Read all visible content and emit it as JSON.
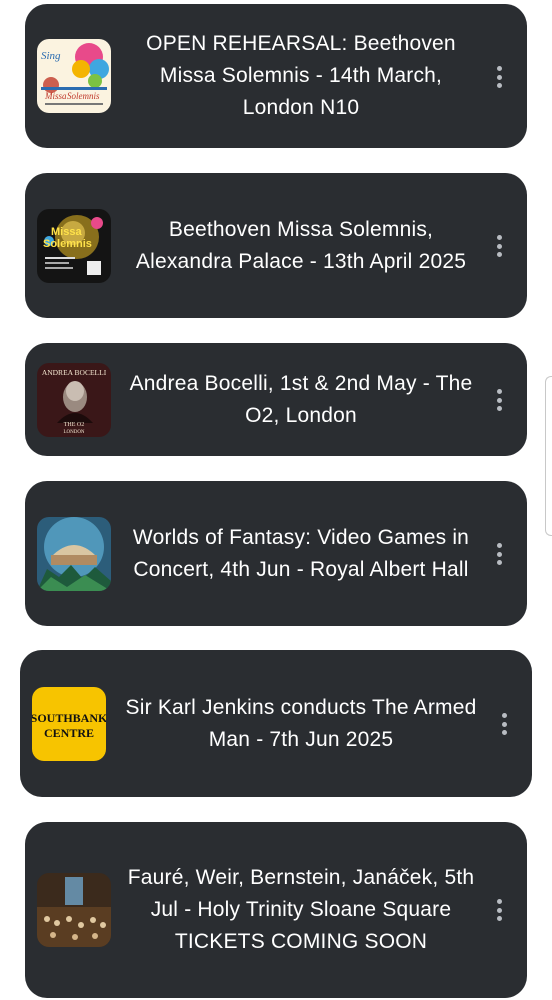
{
  "events": [
    {
      "title": "OPEN REHEARSAL: Beethoven Missa Solemnis - 14th March, London N10",
      "thumb_name": "singfest-missa-solemnis-rehearsal-thumbnail"
    },
    {
      "title": "Beethoven Missa Solemnis, Alexandra Palace - 13th April 2025",
      "thumb_name": "missa-solemnis-poster-thumbnail"
    },
    {
      "title": "Andrea Bocelli, 1st & 2nd May - The O2, London",
      "thumb_name": "andrea-bocelli-poster-thumbnail"
    },
    {
      "title": "Worlds of Fantasy: Video Games in Concert, 4th Jun - Royal Albert Hall",
      "thumb_name": "royal-albert-hall-thumbnail"
    },
    {
      "title": "Sir Karl Jenkins conducts The Armed Man - 7th Jun 2025",
      "thumb_name": "southbank-centre-logo"
    },
    {
      "title": "Fauré, Weir, Bernstein, Janáček, 5th Jul - Holy Trinity Sloane Square TICKETS COMING SOON",
      "thumb_name": "holy-trinity-concert-thumbnail"
    }
  ],
  "thumb_text": {
    "singfest_logo": "Sing",
    "missa_line1": "Missa",
    "missa_line2": "Solemnis",
    "bocelli_name": "ANDREA BOCELLI",
    "bocelli_venue": "THE O2",
    "bocelli_city": "LONDON",
    "southbank_line1": "SOUTHBANK",
    "southbank_line2": "CENTRE"
  },
  "colors": {
    "card_bg": "#2a2d31",
    "card_text": "#ffffff",
    "kebab_dots": "#b8bcc2",
    "southbank_yellow": "#f7c400"
  },
  "icons": [
    "more-vert-icon"
  ]
}
